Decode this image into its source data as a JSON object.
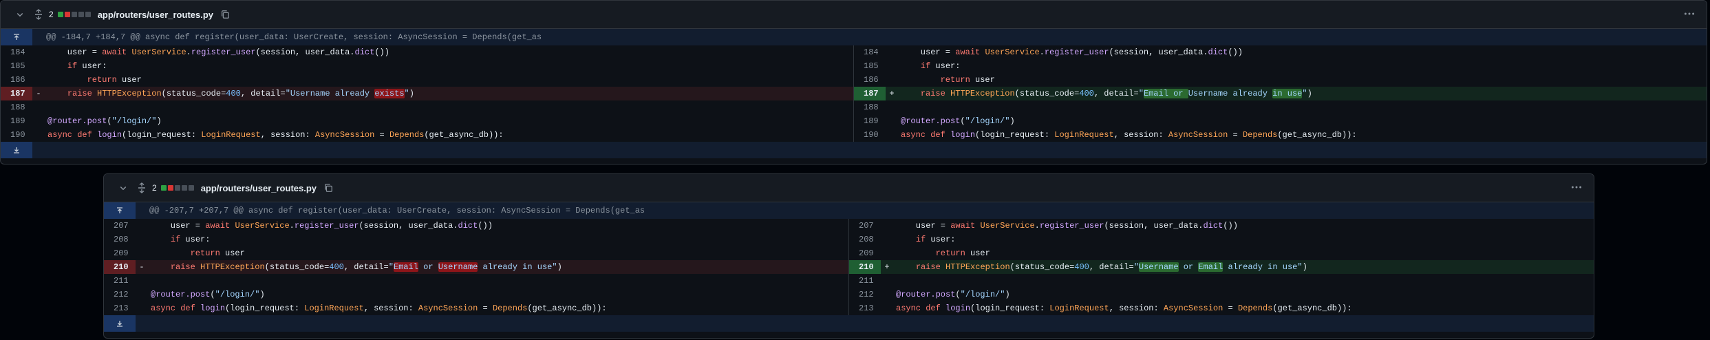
{
  "diffs": [
    {
      "path": "app/routers/user_routes.py",
      "change_count": "2",
      "hunk": "@@ -184,7 +184,7 @@ async def register(user_data: UserCreate, session: AsyncSession = Depends(get_as",
      "left": [
        {
          "num": "184",
          "mark": "",
          "type": "ctx",
          "tokens": [
            [
              "    user = ",
              ""
            ],
            [
              "await",
              "kw"
            ],
            [
              " ",
              ""
            ],
            [
              "UserService",
              "cls"
            ],
            [
              ".",
              ""
            ],
            [
              "register_user",
              "fn"
            ],
            [
              "(session, user_data.",
              ""
            ],
            [
              "dict",
              "fn"
            ],
            [
              "())",
              ""
            ]
          ]
        },
        {
          "num": "185",
          "mark": "",
          "type": "ctx",
          "tokens": [
            [
              "    ",
              ""
            ],
            [
              "if",
              "kw"
            ],
            [
              " user:",
              ""
            ]
          ]
        },
        {
          "num": "186",
          "mark": "",
          "type": "ctx",
          "tokens": [
            [
              "        ",
              ""
            ],
            [
              "return",
              "kw"
            ],
            [
              " user",
              ""
            ]
          ]
        },
        {
          "num": "187",
          "mark": "-",
          "type": "del",
          "tokens": [
            [
              "    ",
              ""
            ],
            [
              "raise",
              "kw"
            ],
            [
              " ",
              ""
            ],
            [
              "HTTPException",
              "cls"
            ],
            [
              "(status_code=",
              ""
            ],
            [
              "400",
              "num"
            ],
            [
              ", detail=",
              ""
            ],
            [
              "\"Username already ",
              "str"
            ],
            [
              "exists",
              "str hl-del"
            ],
            [
              "\"",
              "str"
            ],
            [
              ")",
              ""
            ]
          ]
        },
        {
          "num": "188",
          "mark": "",
          "type": "ctx",
          "tokens": []
        },
        {
          "num": "189",
          "mark": "",
          "type": "ctx",
          "tokens": [
            [
              "@router.post",
              "dec"
            ],
            [
              "(",
              ""
            ],
            [
              "\"/login/\"",
              "str"
            ],
            [
              ")",
              ""
            ]
          ]
        },
        {
          "num": "190",
          "mark": "",
          "type": "ctx",
          "tokens": [
            [
              "async",
              "kw"
            ],
            [
              " ",
              ""
            ],
            [
              "def",
              "kw"
            ],
            [
              " ",
              ""
            ],
            [
              "login",
              "fn"
            ],
            [
              "(login_request: ",
              ""
            ],
            [
              "LoginRequest",
              "cls"
            ],
            [
              ", session: ",
              ""
            ],
            [
              "AsyncSession",
              "cls"
            ],
            [
              " = ",
              ""
            ],
            [
              "Depends",
              "cls"
            ],
            [
              "(get_async_db)):",
              ""
            ]
          ]
        }
      ],
      "right": [
        {
          "num": "184",
          "mark": "",
          "type": "ctx",
          "tokens": [
            [
              "    user = ",
              ""
            ],
            [
              "await",
              "kw"
            ],
            [
              " ",
              ""
            ],
            [
              "UserService",
              "cls"
            ],
            [
              ".",
              ""
            ],
            [
              "register_user",
              "fn"
            ],
            [
              "(session, user_data.",
              ""
            ],
            [
              "dict",
              "fn"
            ],
            [
              "())",
              ""
            ]
          ]
        },
        {
          "num": "185",
          "mark": "",
          "type": "ctx",
          "tokens": [
            [
              "    ",
              ""
            ],
            [
              "if",
              "kw"
            ],
            [
              " user:",
              ""
            ]
          ]
        },
        {
          "num": "186",
          "mark": "",
          "type": "ctx",
          "tokens": [
            [
              "        ",
              ""
            ],
            [
              "return",
              "kw"
            ],
            [
              " user",
              ""
            ]
          ]
        },
        {
          "num": "187",
          "mark": "+",
          "type": "add",
          "tokens": [
            [
              "    ",
              ""
            ],
            [
              "raise",
              "kw"
            ],
            [
              " ",
              ""
            ],
            [
              "HTTPException",
              "cls"
            ],
            [
              "(status_code=",
              ""
            ],
            [
              "400",
              "num"
            ],
            [
              ", detail=",
              ""
            ],
            [
              "\"",
              "str"
            ],
            [
              "Email or ",
              "str hl-add"
            ],
            [
              "Username already ",
              "str"
            ],
            [
              "in use",
              "str hl-add"
            ],
            [
              "\"",
              "str"
            ],
            [
              ")",
              ""
            ]
          ]
        },
        {
          "num": "188",
          "mark": "",
          "type": "ctx",
          "tokens": []
        },
        {
          "num": "189",
          "mark": "",
          "type": "ctx",
          "tokens": [
            [
              "@router.post",
              "dec"
            ],
            [
              "(",
              ""
            ],
            [
              "\"/login/\"",
              "str"
            ],
            [
              ")",
              ""
            ]
          ]
        },
        {
          "num": "190",
          "mark": "",
          "type": "ctx",
          "tokens": [
            [
              "async",
              "kw"
            ],
            [
              " ",
              ""
            ],
            [
              "def",
              "kw"
            ],
            [
              " ",
              ""
            ],
            [
              "login",
              "fn"
            ],
            [
              "(login_request: ",
              ""
            ],
            [
              "LoginRequest",
              "cls"
            ],
            [
              ", session: ",
              ""
            ],
            [
              "AsyncSession",
              "cls"
            ],
            [
              " = ",
              ""
            ],
            [
              "Depends",
              "cls"
            ],
            [
              "(get_async_db)):",
              ""
            ]
          ]
        }
      ]
    },
    {
      "path": "app/routers/user_routes.py",
      "change_count": "2",
      "hunk": "@@ -207,7 +207,7 @@ async def register(user_data: UserCreate, session: AsyncSession = Depends(get_as",
      "left": [
        {
          "num": "207",
          "mark": "",
          "type": "ctx",
          "tokens": [
            [
              "    user = ",
              ""
            ],
            [
              "await",
              "kw"
            ],
            [
              " ",
              ""
            ],
            [
              "UserService",
              "cls"
            ],
            [
              ".",
              ""
            ],
            [
              "register_user",
              "fn"
            ],
            [
              "(session, user_data.",
              ""
            ],
            [
              "dict",
              "fn"
            ],
            [
              "())",
              ""
            ]
          ]
        },
        {
          "num": "208",
          "mark": "",
          "type": "ctx",
          "tokens": [
            [
              "    ",
              ""
            ],
            [
              "if",
              "kw"
            ],
            [
              " user:",
              ""
            ]
          ]
        },
        {
          "num": "209",
          "mark": "",
          "type": "ctx",
          "tokens": [
            [
              "        ",
              ""
            ],
            [
              "return",
              "kw"
            ],
            [
              " user",
              ""
            ]
          ]
        },
        {
          "num": "210",
          "mark": "-",
          "type": "del",
          "tokens": [
            [
              "    ",
              ""
            ],
            [
              "raise",
              "kw"
            ],
            [
              " ",
              ""
            ],
            [
              "HTTPException",
              "cls"
            ],
            [
              "(status_code=",
              ""
            ],
            [
              "400",
              "num"
            ],
            [
              ", detail=",
              ""
            ],
            [
              "\"",
              "str"
            ],
            [
              "Email",
              "str hl-del"
            ],
            [
              " or ",
              "str"
            ],
            [
              "Username",
              "str hl-del"
            ],
            [
              " already in use\"",
              "str"
            ],
            [
              ")",
              ""
            ]
          ]
        },
        {
          "num": "211",
          "mark": "",
          "type": "ctx",
          "tokens": []
        },
        {
          "num": "212",
          "mark": "",
          "type": "ctx",
          "tokens": [
            [
              "@router.post",
              "dec"
            ],
            [
              "(",
              ""
            ],
            [
              "\"/login/\"",
              "str"
            ],
            [
              ")",
              ""
            ]
          ]
        },
        {
          "num": "213",
          "mark": "",
          "type": "ctx",
          "tokens": [
            [
              "async",
              "kw"
            ],
            [
              " ",
              ""
            ],
            [
              "def",
              "kw"
            ],
            [
              " ",
              ""
            ],
            [
              "login",
              "fn"
            ],
            [
              "(login_request: ",
              ""
            ],
            [
              "LoginRequest",
              "cls"
            ],
            [
              ", session: ",
              ""
            ],
            [
              "AsyncSession",
              "cls"
            ],
            [
              " = ",
              ""
            ],
            [
              "Depends",
              "cls"
            ],
            [
              "(get_async_db)):",
              ""
            ]
          ]
        }
      ],
      "right": [
        {
          "num": "207",
          "mark": "",
          "type": "ctx",
          "tokens": [
            [
              "    user = ",
              ""
            ],
            [
              "await",
              "kw"
            ],
            [
              " ",
              ""
            ],
            [
              "UserService",
              "cls"
            ],
            [
              ".",
              ""
            ],
            [
              "register_user",
              "fn"
            ],
            [
              "(session, user_data.",
              ""
            ],
            [
              "dict",
              "fn"
            ],
            [
              "())",
              ""
            ]
          ]
        },
        {
          "num": "208",
          "mark": "",
          "type": "ctx",
          "tokens": [
            [
              "    ",
              ""
            ],
            [
              "if",
              "kw"
            ],
            [
              " user:",
              ""
            ]
          ]
        },
        {
          "num": "209",
          "mark": "",
          "type": "ctx",
          "tokens": [
            [
              "        ",
              ""
            ],
            [
              "return",
              "kw"
            ],
            [
              " user",
              ""
            ]
          ]
        },
        {
          "num": "210",
          "mark": "+",
          "type": "add",
          "tokens": [
            [
              "    ",
              ""
            ],
            [
              "raise",
              "kw"
            ],
            [
              " ",
              ""
            ],
            [
              "HTTPException",
              "cls"
            ],
            [
              "(status_code=",
              ""
            ],
            [
              "400",
              "num"
            ],
            [
              ", detail=",
              ""
            ],
            [
              "\"",
              "str"
            ],
            [
              "Username",
              "str hl-add"
            ],
            [
              " or ",
              "str"
            ],
            [
              "Email",
              "str hl-add"
            ],
            [
              " already in use\"",
              "str"
            ],
            [
              ")",
              ""
            ]
          ]
        },
        {
          "num": "211",
          "mark": "",
          "type": "ctx",
          "tokens": []
        },
        {
          "num": "212",
          "mark": "",
          "type": "ctx",
          "tokens": [
            [
              "@router.post",
              "dec"
            ],
            [
              "(",
              ""
            ],
            [
              "\"/login/\"",
              "str"
            ],
            [
              ")",
              ""
            ]
          ]
        },
        {
          "num": "213",
          "mark": "",
          "type": "ctx",
          "tokens": [
            [
              "async",
              "kw"
            ],
            [
              " ",
              ""
            ],
            [
              "def",
              "kw"
            ],
            [
              " ",
              ""
            ],
            [
              "login",
              "fn"
            ],
            [
              "(login_request: ",
              ""
            ],
            [
              "LoginRequest",
              "cls"
            ],
            [
              ", session: ",
              ""
            ],
            [
              "AsyncSession",
              "cls"
            ],
            [
              " = ",
              ""
            ],
            [
              "Depends",
              "cls"
            ],
            [
              "(get_async_db)):",
              ""
            ]
          ]
        }
      ]
    }
  ],
  "icons": {
    "collapse": "chevron-down-icon",
    "expand_all": "unfold-icon",
    "copy": "copy-icon",
    "menu": "kebab-horizontal-icon",
    "expand_up": "expand-up-icon",
    "expand_down": "expand-down-icon"
  },
  "colors": {
    "added": "#2ea043",
    "deleted": "#da3633",
    "neutral": "#484f58",
    "accent": "#1f6feb"
  }
}
